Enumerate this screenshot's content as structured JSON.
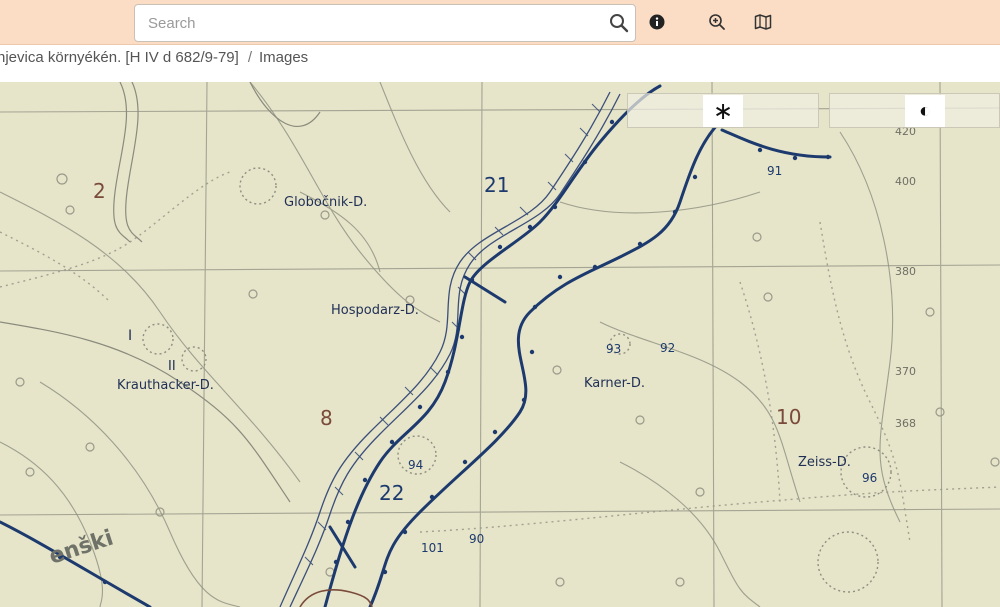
{
  "search": {
    "placeholder": "Search"
  },
  "toolbar": {
    "info_icon": "info-icon",
    "zoom_icon": "zoom-in-icon",
    "map_icon": "map-icon"
  },
  "breadcrumb": {
    "title": "njevica környékén. [H IV d 682/9-79]",
    "separator": "/",
    "current": "Images"
  },
  "viewer": {
    "rotate_button": "∗",
    "contrast_button": "◐"
  },
  "map": {
    "labels": {
      "globocnik": "Globočnik-D.",
      "hospodarz": "Hospodarz-D.",
      "krauthacker": "Krauthacker-D.",
      "karner": "Karner-D.",
      "zeiss": "Zeiss-D.",
      "henski": "enški",
      "roman_one": "I",
      "roman_two": "II"
    },
    "sector_numbers": {
      "n2": "2",
      "n8": "8",
      "n10": "10",
      "n21": "21",
      "n22": "22"
    },
    "points": {
      "p91": "91",
      "p93": "93",
      "p92": "92",
      "p94": "94",
      "p96": "96",
      "p101": "101",
      "p90": "90"
    },
    "grid_elevations": {
      "e420": "420",
      "e400": "400",
      "e380": "380",
      "e370": "370",
      "e368": "368"
    },
    "colors": {
      "paper": "#e9e6cd",
      "ink_blue": "#1d3a6e",
      "ink_brown": "#7a4a3a",
      "grid": "#9a9a8a"
    }
  }
}
